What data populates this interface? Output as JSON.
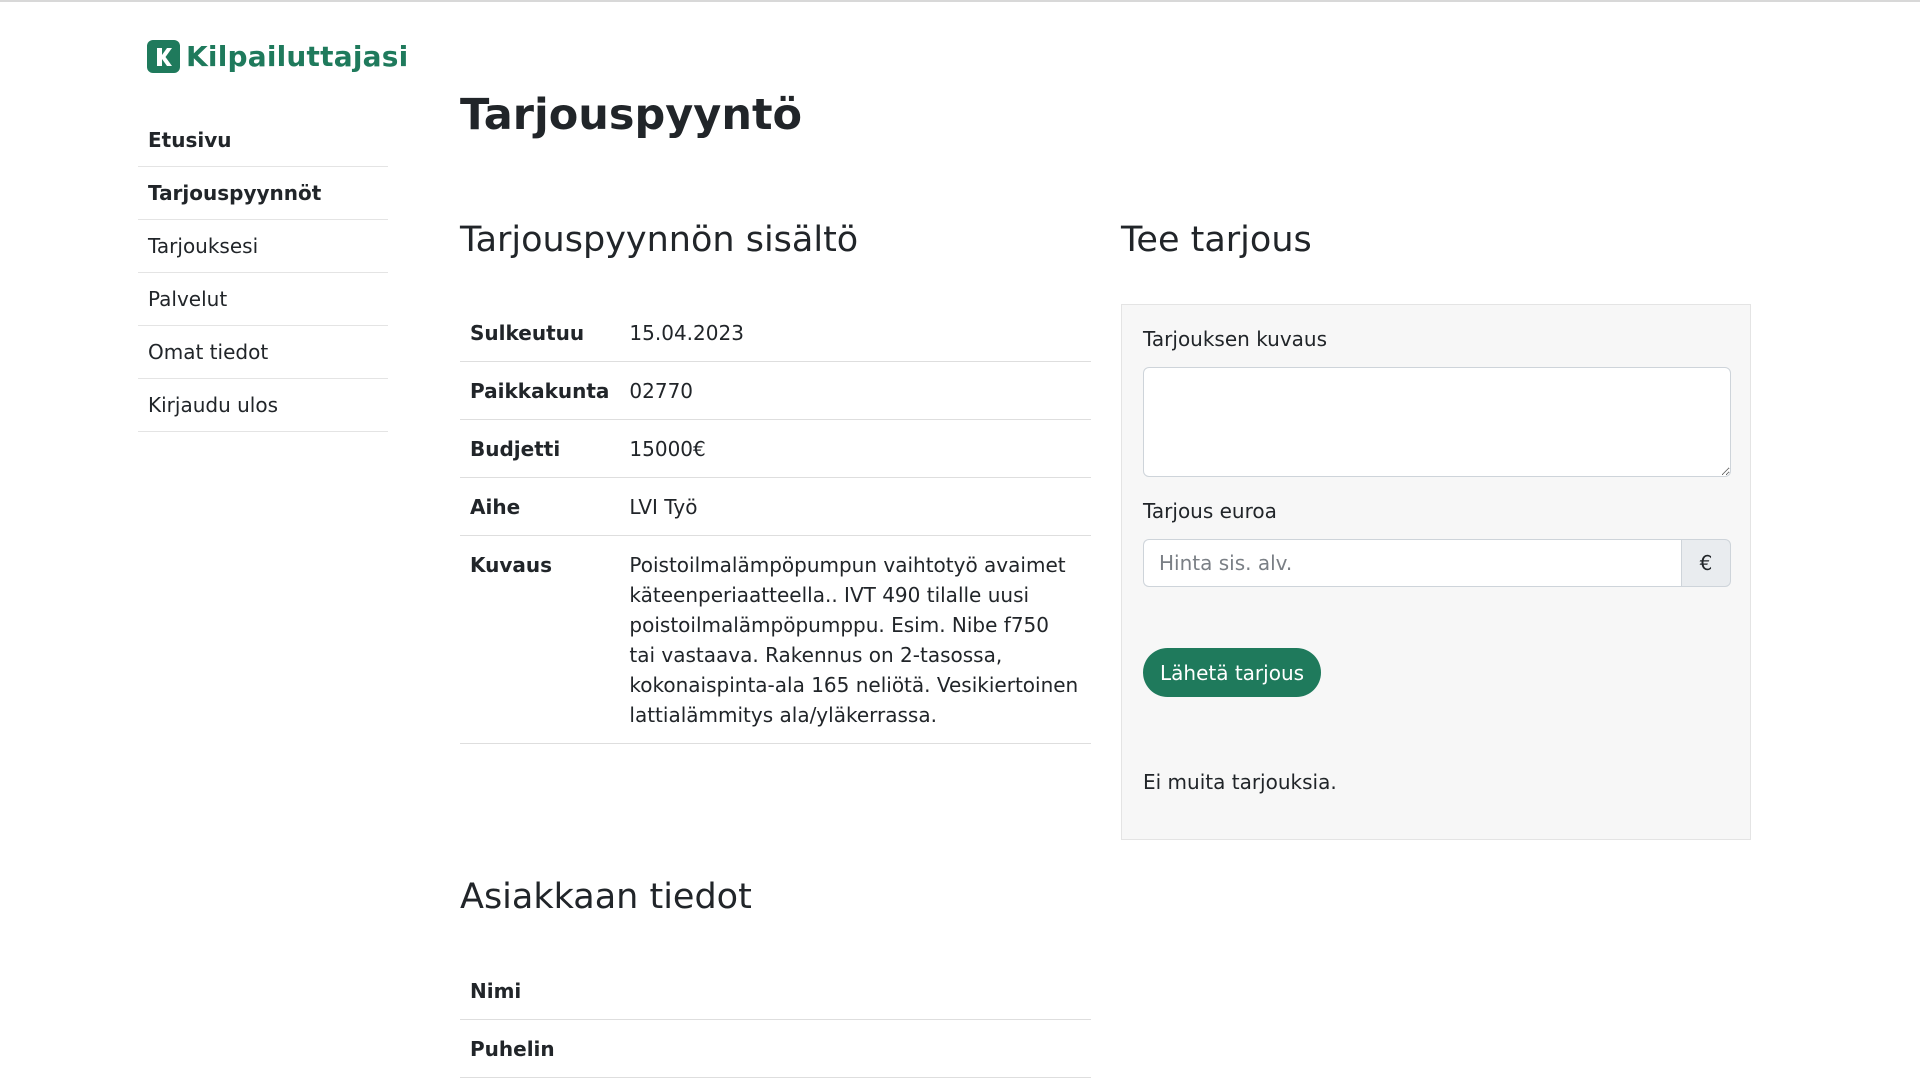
{
  "brand": {
    "name": "Kilpailuttajasi",
    "color": "#1f7a5c"
  },
  "sidebar": {
    "items": [
      {
        "label": "Etusivu"
      },
      {
        "label": "Tarjouspyynnöt"
      },
      {
        "label": "Tarjouksesi"
      },
      {
        "label": "Palvelut"
      },
      {
        "label": "Omat tiedot"
      },
      {
        "label": "Kirjaudu ulos"
      }
    ]
  },
  "page": {
    "title": "Tarjouspyyntö"
  },
  "request": {
    "title": "Tarjouspyynnön sisältö",
    "rows": [
      {
        "key": "Sulkeutuu",
        "value": "15.04.2023"
      },
      {
        "key": "Paikkakunta",
        "value": "02770"
      },
      {
        "key": "Budjetti",
        "value": "15000€"
      },
      {
        "key": "Aihe",
        "value": "LVI Työ"
      },
      {
        "key": "Kuvaus",
        "value": "Poistoilmalämpöpumpun vaihtotyö avaimet käteenperiaatteella.. IVT 490 tilalle uusi poistoilmalämpöpumppu. Esim. Nibe f750 tai vastaava. Rakennus on 2-tasossa, kokonaispinta-ala 165 neliötä. Vesikiertoinen lattialämmitys ala/yläkerrassa."
      }
    ]
  },
  "offer": {
    "title": "Tee tarjous",
    "description_label": "Tarjouksen kuvaus",
    "description_value": "",
    "price_label": "Tarjous euroa",
    "price_placeholder": "Hinta sis. alv.",
    "currency_symbol": "€",
    "submit_label": "Lähetä tarjous",
    "no_offers_text": "Ei muita tarjouksia."
  },
  "customer": {
    "title": "Asiakkaan tiedot",
    "rows": [
      {
        "key": "Nimi",
        "value": ""
      },
      {
        "key": "Puhelin",
        "value": ""
      }
    ]
  }
}
